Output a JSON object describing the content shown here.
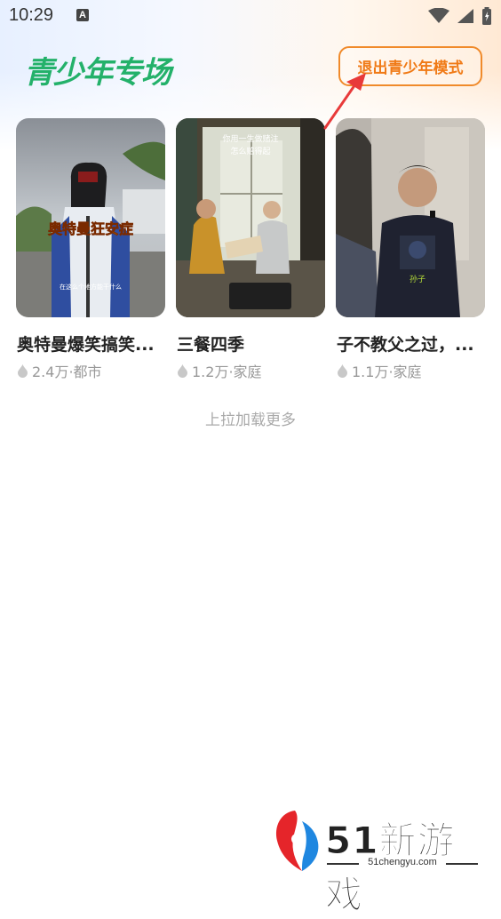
{
  "status_bar": {
    "time": "10:29",
    "a_badge": "A",
    "icons": [
      "wifi-icon",
      "signal-icon",
      "battery-icon"
    ]
  },
  "header": {
    "brand_logo": "青少年专场",
    "exit_button_label": "退出青少年模式"
  },
  "colors": {
    "brand_green": "#23b16a",
    "accent_orange": "#f07a16",
    "annotation_red": "#e83a3a",
    "meta_gray": "#999999"
  },
  "cards": [
    {
      "title": "奥特曼爆笑搞笑...",
      "views": "2.4万",
      "category": "·都市",
      "thumb_caption": "奥特曼狂安症",
      "thumb_subcaption": "在这么个地方能干什么"
    },
    {
      "title": "三餐四季",
      "views": "1.2万",
      "category": "·家庭",
      "thumb_caption": "你用一生做赌注\n怎么赔得起"
    },
    {
      "title": "子不教父之过，...",
      "views": "1.1万",
      "category": "·家庭",
      "thumb_caption": "孙子"
    }
  ],
  "load_more": "上拉加载更多",
  "watermark": {
    "title": "51新游戏",
    "url": "51chengyu.com"
  }
}
